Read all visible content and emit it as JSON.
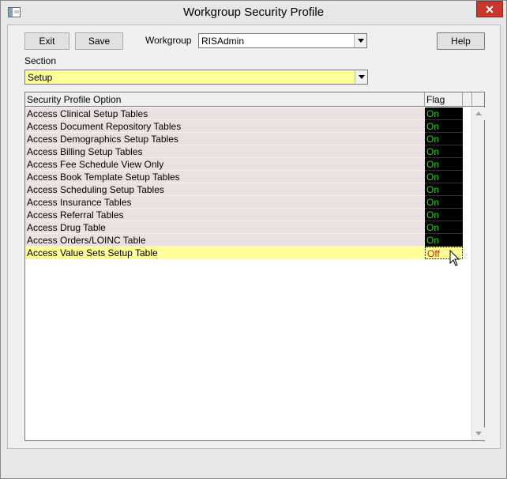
{
  "window": {
    "title": "Workgroup Security Profile",
    "close_glyph": "✕"
  },
  "toolbar": {
    "exit_label": "Exit",
    "save_label": "Save",
    "help_label": "Help"
  },
  "workgroup": {
    "label": "Workgroup",
    "value": "RISAdmin"
  },
  "section": {
    "label": "Section",
    "value": "Setup"
  },
  "grid": {
    "columns": [
      "Security Profile Option",
      "Flag"
    ],
    "rows": [
      {
        "option": "Access Clinical Setup Tables",
        "flag": "On"
      },
      {
        "option": "Access Document Repository Tables",
        "flag": "On"
      },
      {
        "option": "Access Demographics Setup Tables",
        "flag": "On"
      },
      {
        "option": "Access Billing Setup Tables",
        "flag": "On"
      },
      {
        "option": "Access Fee Schedule View Only",
        "flag": "On"
      },
      {
        "option": "Access Book Template Setup Tables",
        "flag": "On"
      },
      {
        "option": "Access Scheduling Setup Tables",
        "flag": "On"
      },
      {
        "option": "Access Insurance Tables",
        "flag": "On"
      },
      {
        "option": "Access Referral Tables",
        "flag": "On"
      },
      {
        "option": "Access Drug Table",
        "flag": "On"
      },
      {
        "option": "Access Orders/LOINC Table",
        "flag": "On"
      },
      {
        "option": "Access Value Sets Setup Table",
        "flag": "Off"
      }
    ]
  },
  "colors": {
    "highlight": "#ffff99",
    "row_bg": "#ebe0e0",
    "flag_on": "#33cc33",
    "flag_off": "#cc2200",
    "close_bg": "#c7362b"
  },
  "icons": {
    "app": "app-window-icon",
    "close": "close-icon",
    "dropdown": "chevron-down-icon",
    "scroll_up": "scroll-up-arrow-icon",
    "scroll_down": "scroll-down-arrow-icon",
    "cursor": "mouse-pointer-icon"
  }
}
